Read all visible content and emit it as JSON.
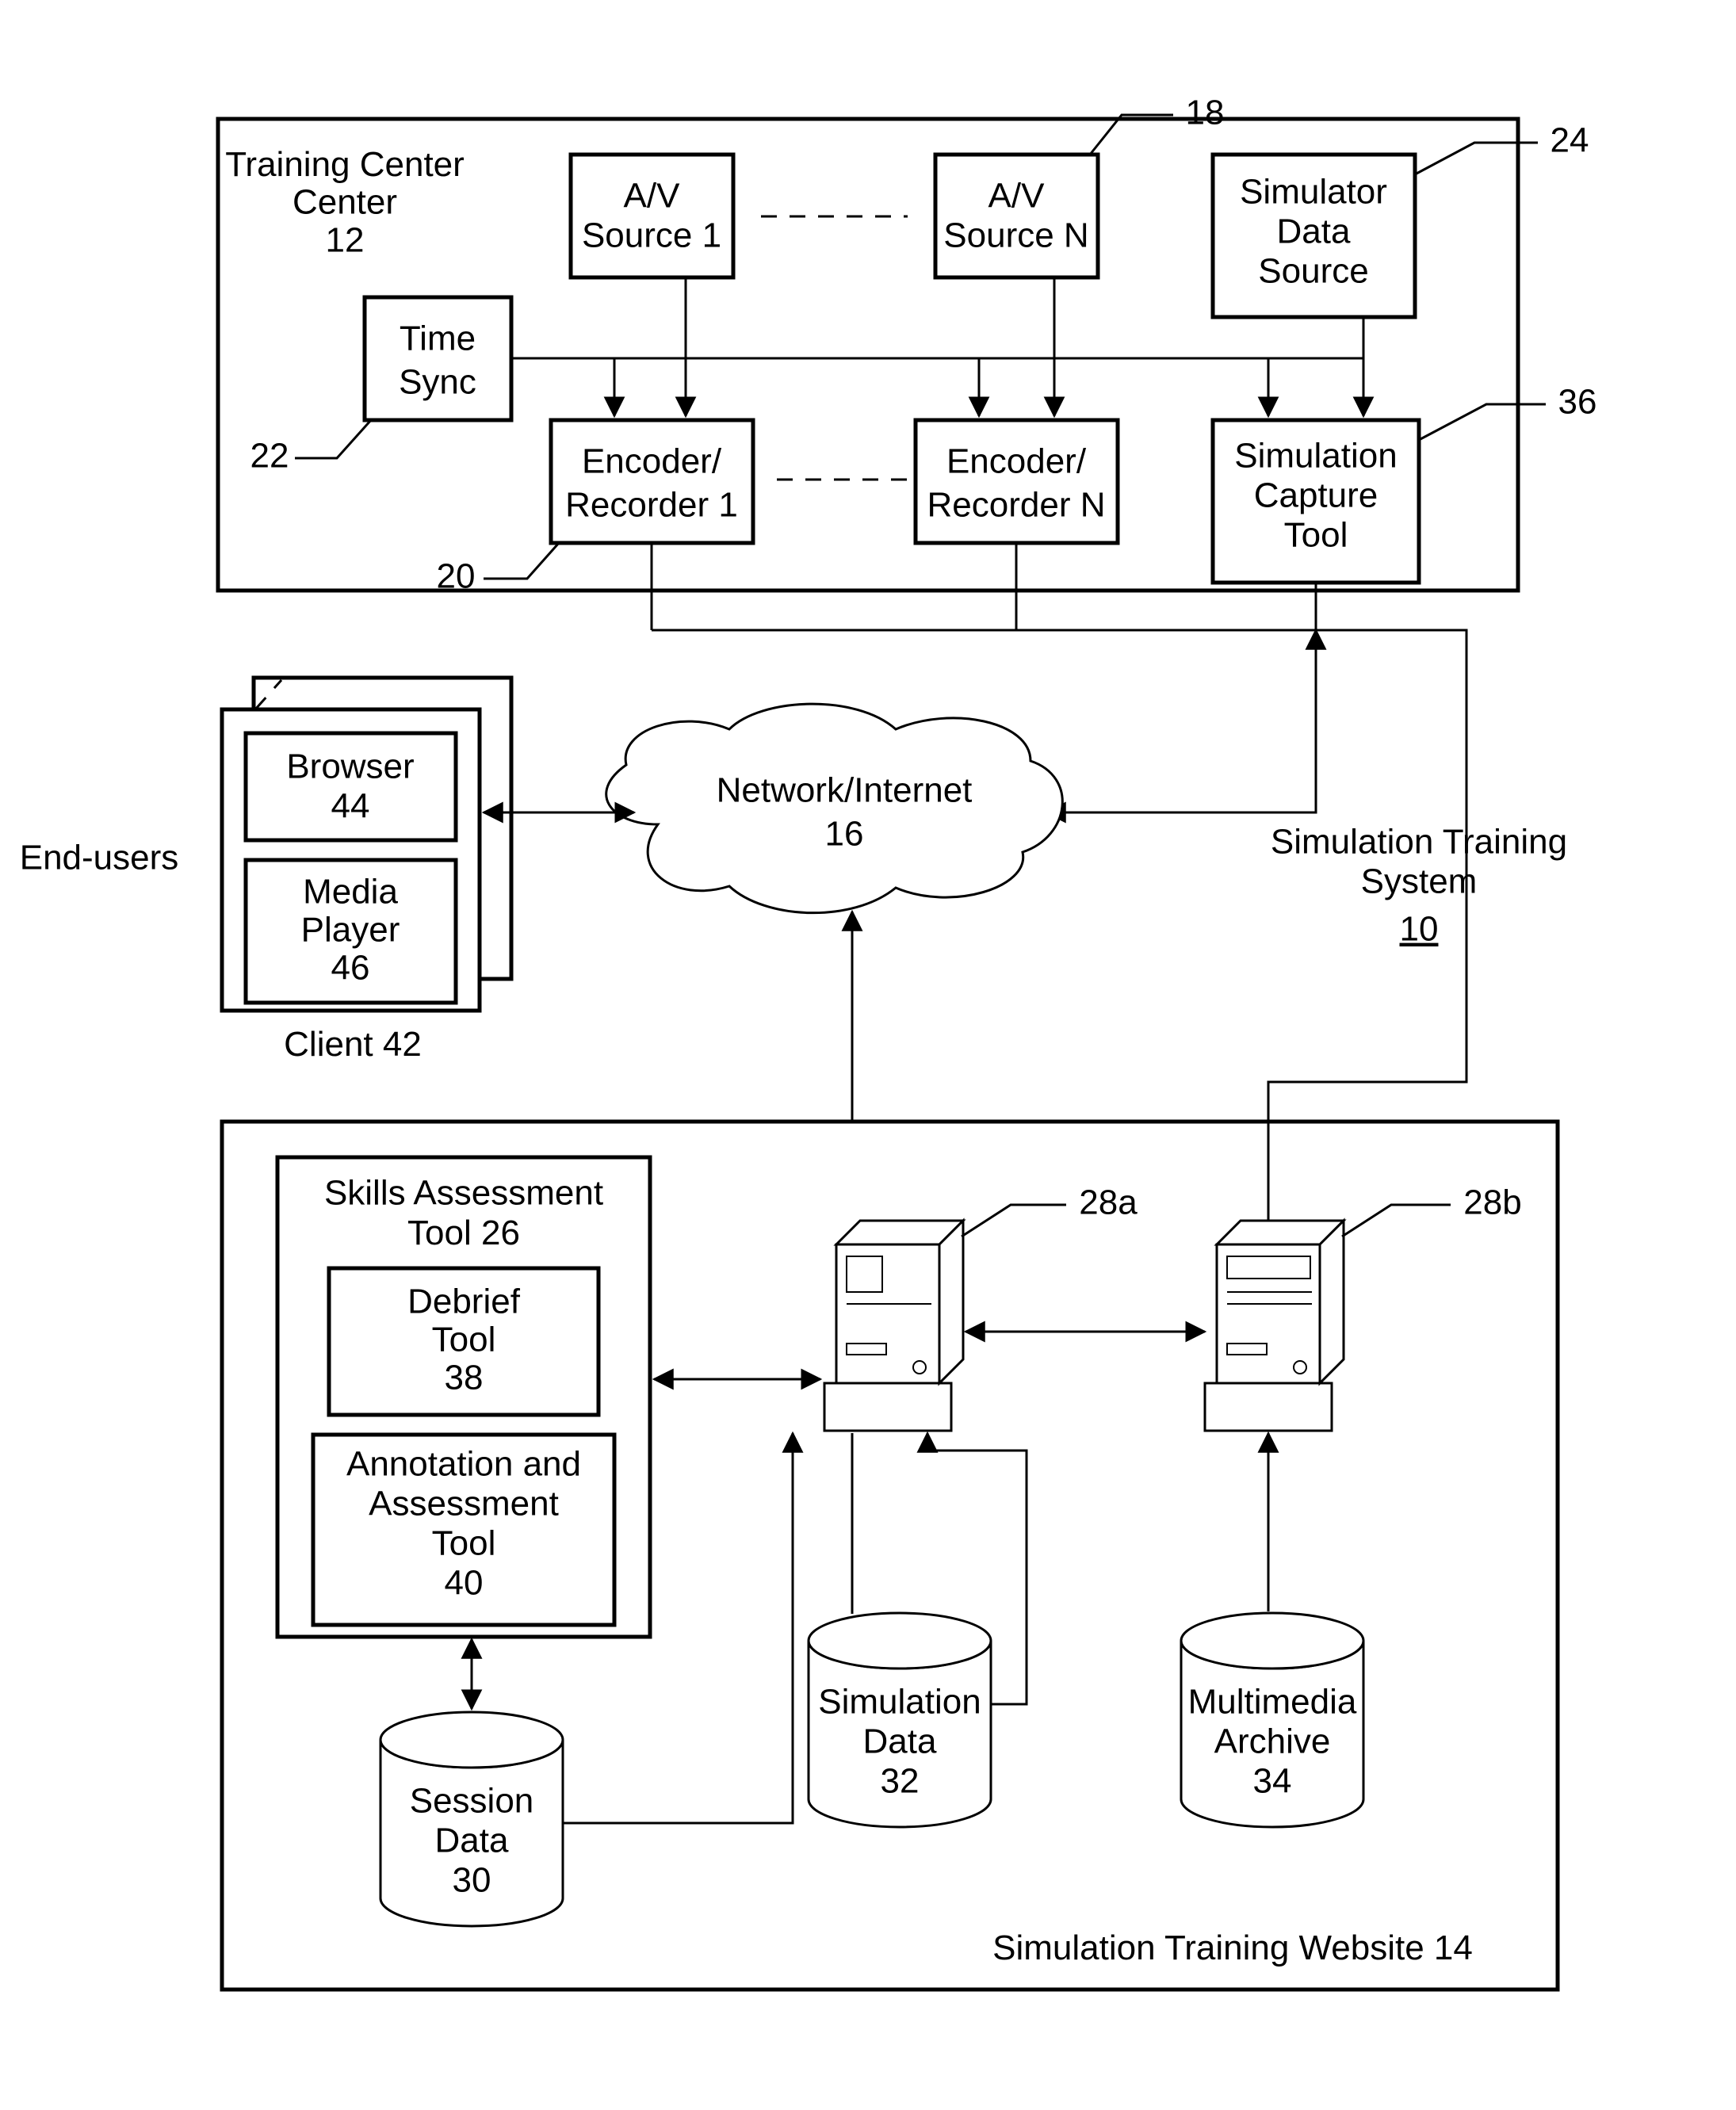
{
  "trainingCenter": {
    "title": "Training Center",
    "ref": "12"
  },
  "avSource1": {
    "title": "A/V Source 1"
  },
  "avSourceN": {
    "title": "A/V Source N",
    "ref": "18"
  },
  "simDataSource": {
    "title": "Simulator Data Source",
    "ref": "24"
  },
  "timeSync": {
    "title": "Time Sync",
    "ref": "22"
  },
  "recorder1": {
    "title": "Encoder/ Recorder 1",
    "ref": "20"
  },
  "recorderN": {
    "title": "Encoder/ Recorder N"
  },
  "simCapture": {
    "title": "Simulation Capture Tool",
    "ref": "36"
  },
  "endUsers": "End-users",
  "browser": {
    "title": "Browser",
    "ref": "44"
  },
  "mediaPlayer": {
    "title": "Media Player",
    "ref": "46"
  },
  "client": {
    "title": "Client",
    "ref": "42"
  },
  "network": {
    "title": "Network/Internet",
    "ref": "16"
  },
  "simTrainingSystem": {
    "title": "Simulation Training System",
    "ref": "10"
  },
  "skillsAssess": {
    "title": "Skills Assessment Tool",
    "ref": "26"
  },
  "debrief": {
    "title": "Debrief Tool",
    "ref": "38"
  },
  "annoAssess": {
    "title": "Annotation and Assessment Tool",
    "ref": "40"
  },
  "server1": {
    "ref": "28a"
  },
  "server2": {
    "ref": "28b"
  },
  "sessionData": {
    "title": "Session Data",
    "ref": "30"
  },
  "simData": {
    "title": "Simulation Data",
    "ref": "32"
  },
  "mmArchive": {
    "title": "Multimedia Archive",
    "ref": "34"
  },
  "simWebsite": {
    "title": "Simulation Training Website",
    "ref": "14"
  }
}
